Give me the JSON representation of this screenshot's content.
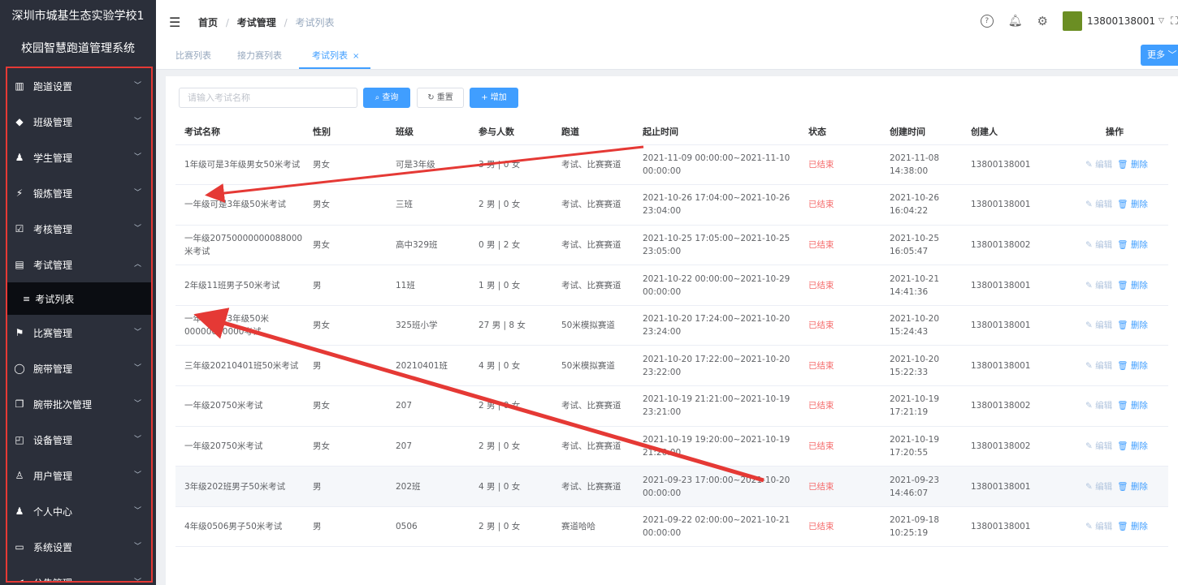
{
  "sidebar": {
    "school": "深圳市城基生态实验学校1",
    "system": "校园智慧跑道管理系统",
    "items": [
      {
        "label": "跑道设置",
        "icon": "track-icon"
      },
      {
        "label": "班级管理",
        "icon": "graduation-cap-icon"
      },
      {
        "label": "学生管理",
        "icon": "student-icon"
      },
      {
        "label": "锻炼管理",
        "icon": "running-icon"
      },
      {
        "label": "考核管理",
        "icon": "checklist-icon"
      },
      {
        "label": "考试管理",
        "icon": "exam-icon"
      }
    ],
    "active_sub": "考试列表",
    "items_after": [
      {
        "label": "比赛管理",
        "icon": "flag-icon"
      },
      {
        "label": "腕带管理",
        "icon": "wristband-icon"
      },
      {
        "label": "腕带批次管理",
        "icon": "batch-icon"
      },
      {
        "label": "设备管理",
        "icon": "device-icon"
      },
      {
        "label": "用户管理",
        "icon": "user-icon"
      },
      {
        "label": "个人中心",
        "icon": "person-icon"
      },
      {
        "label": "系统设置",
        "icon": "monitor-icon"
      },
      {
        "label": "公告管理",
        "icon": "announcement-icon"
      }
    ]
  },
  "header": {
    "breadcrumb": [
      "首页",
      "考试管理",
      "考试列表"
    ],
    "username": "13800138001"
  },
  "tabs": [
    {
      "label": "比赛列表"
    },
    {
      "label": "接力赛列表"
    },
    {
      "label": "考试列表",
      "active": true
    }
  ],
  "more_label": "更多",
  "toolbar": {
    "search_placeholder": "请输入考试名称",
    "query_label": "查询",
    "reset_label": "重置",
    "add_label": "增加"
  },
  "table": {
    "columns": [
      "考试名称",
      "性别",
      "班级",
      "参与人数",
      "跑道",
      "起止时间",
      "状态",
      "创建时间",
      "创建人",
      "操作"
    ],
    "edit_label": "编辑",
    "delete_label": "删除",
    "rows": [
      {
        "name": "1年级可是3年级男女50米考试",
        "gender": "男女",
        "class": "可是3年级",
        "count": "3 男 | 0 女",
        "track": "考试、比赛赛道",
        "time": "2021-11-09 00:00:00~2021-11-10 00:00:00",
        "status": "已结束",
        "created": "2021-11-08 14:38:00",
        "creator": "13800138001"
      },
      {
        "name": "一年级可是3年级50米考试",
        "gender": "男女",
        "class": "三班",
        "count": "2 男 | 0 女",
        "track": "考试、比赛赛道",
        "time": "2021-10-26 17:04:00~2021-10-26 23:04:00",
        "status": "已结束",
        "created": "2021-10-26 16:04:22",
        "creator": "13800138001"
      },
      {
        "name": "一年级20750000000088000米考试",
        "gender": "男女",
        "class": "高中329班",
        "count": "0 男 | 2 女",
        "track": "考试、比赛赛道",
        "time": "2021-10-25 17:05:00~2021-10-25 23:05:00",
        "status": "已结束",
        "created": "2021-10-25 16:05:47",
        "creator": "13800138002"
      },
      {
        "name": "2年级11班男子50米考试",
        "gender": "男",
        "class": "11班",
        "count": "1 男 | 0 女",
        "track": "考试、比赛赛道",
        "time": "2021-10-22 00:00:00~2021-10-29 00:00:00",
        "status": "已结束",
        "created": "2021-10-21 14:41:36",
        "creator": "13800138001"
      },
      {
        "name": "一年级可是3年级50米00000000000考试",
        "gender": "男女",
        "class": "325班小学",
        "count": "27 男 | 8 女",
        "track": "50米模拟赛道",
        "time": "2021-10-20 17:24:00~2021-10-20 23:24:00",
        "status": "已结束",
        "created": "2021-10-20 15:24:43",
        "creator": "13800138001"
      },
      {
        "name": "三年级20210401班50米考试",
        "gender": "男",
        "class": "20210401班",
        "count": "4 男 | 0 女",
        "track": "50米模拟赛道",
        "time": "2021-10-20 17:22:00~2021-10-20 23:22:00",
        "status": "已结束",
        "created": "2021-10-20 15:22:33",
        "creator": "13800138001"
      },
      {
        "name": "一年级20750米考试",
        "gender": "男女",
        "class": "207",
        "count": "2 男 | 0 女",
        "track": "考试、比赛赛道",
        "time": "2021-10-19 21:21:00~2021-10-19 23:21:00",
        "status": "已结束",
        "created": "2021-10-19 17:21:19",
        "creator": "13800138002"
      },
      {
        "name": "一年级20750米考试",
        "gender": "男女",
        "class": "207",
        "count": "2 男 | 0 女",
        "track": "考试、比赛赛道",
        "time": "2021-10-19 19:20:00~2021-10-19 21:20:00",
        "status": "已结束",
        "created": "2021-10-19 17:20:55",
        "creator": "13800138002"
      },
      {
        "name": "3年级202班男子50米考试",
        "gender": "男",
        "class": "202班",
        "count": "4 男 | 0 女",
        "track": "考试、比赛赛道",
        "time": "2021-09-23 17:00:00~2021-10-20 00:00:00",
        "status": "已结束",
        "created": "2021-09-23 14:46:07",
        "creator": "13800138001",
        "highlight": true
      },
      {
        "name": "4年级0506男子50米考试",
        "gender": "男",
        "class": "0506",
        "count": "2 男 | 0 女",
        "track": "赛道哈哈",
        "time": "2021-09-22 02:00:00~2021-10-21 00:00:00",
        "status": "已结束",
        "created": "2021-09-18 10:25:19",
        "creator": "13800138001"
      }
    ]
  },
  "colors": {
    "primary": "#409eff",
    "sidebar_bg": "#2b2f3a",
    "status_ended": "#f56c6c",
    "annotation": "#e53935"
  }
}
